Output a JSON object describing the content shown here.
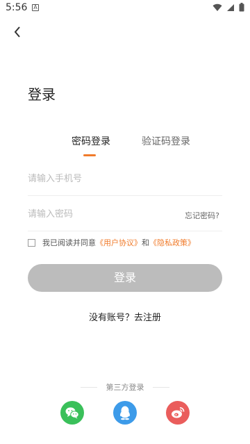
{
  "status_bar": {
    "time": "5:56",
    "notification_letter": "A"
  },
  "header": {
    "title": "登录"
  },
  "tabs": [
    {
      "label": "密码登录",
      "active": true
    },
    {
      "label": "验证码登录",
      "active": false
    }
  ],
  "form": {
    "phone_placeholder": "请输入手机号",
    "password_placeholder": "请输入密码",
    "forgot_label": "忘记密码?"
  },
  "agreement": {
    "prefix": "我已阅读并同意",
    "user_agreement": "《用户协议》",
    "connector": "和",
    "privacy_policy": "《隐私政策》",
    "checked": false
  },
  "login_button": "登录",
  "register_link": "没有账号？去注册",
  "third_party": {
    "label": "第三方登录",
    "providers": [
      "wechat",
      "qq",
      "weibo"
    ]
  },
  "colors": {
    "accent": "#f07b2b",
    "button_disabled": "#bcbcbc",
    "wechat": "#3ac05a",
    "qq": "#3d9be9",
    "weibo": "#ea5d5c"
  }
}
